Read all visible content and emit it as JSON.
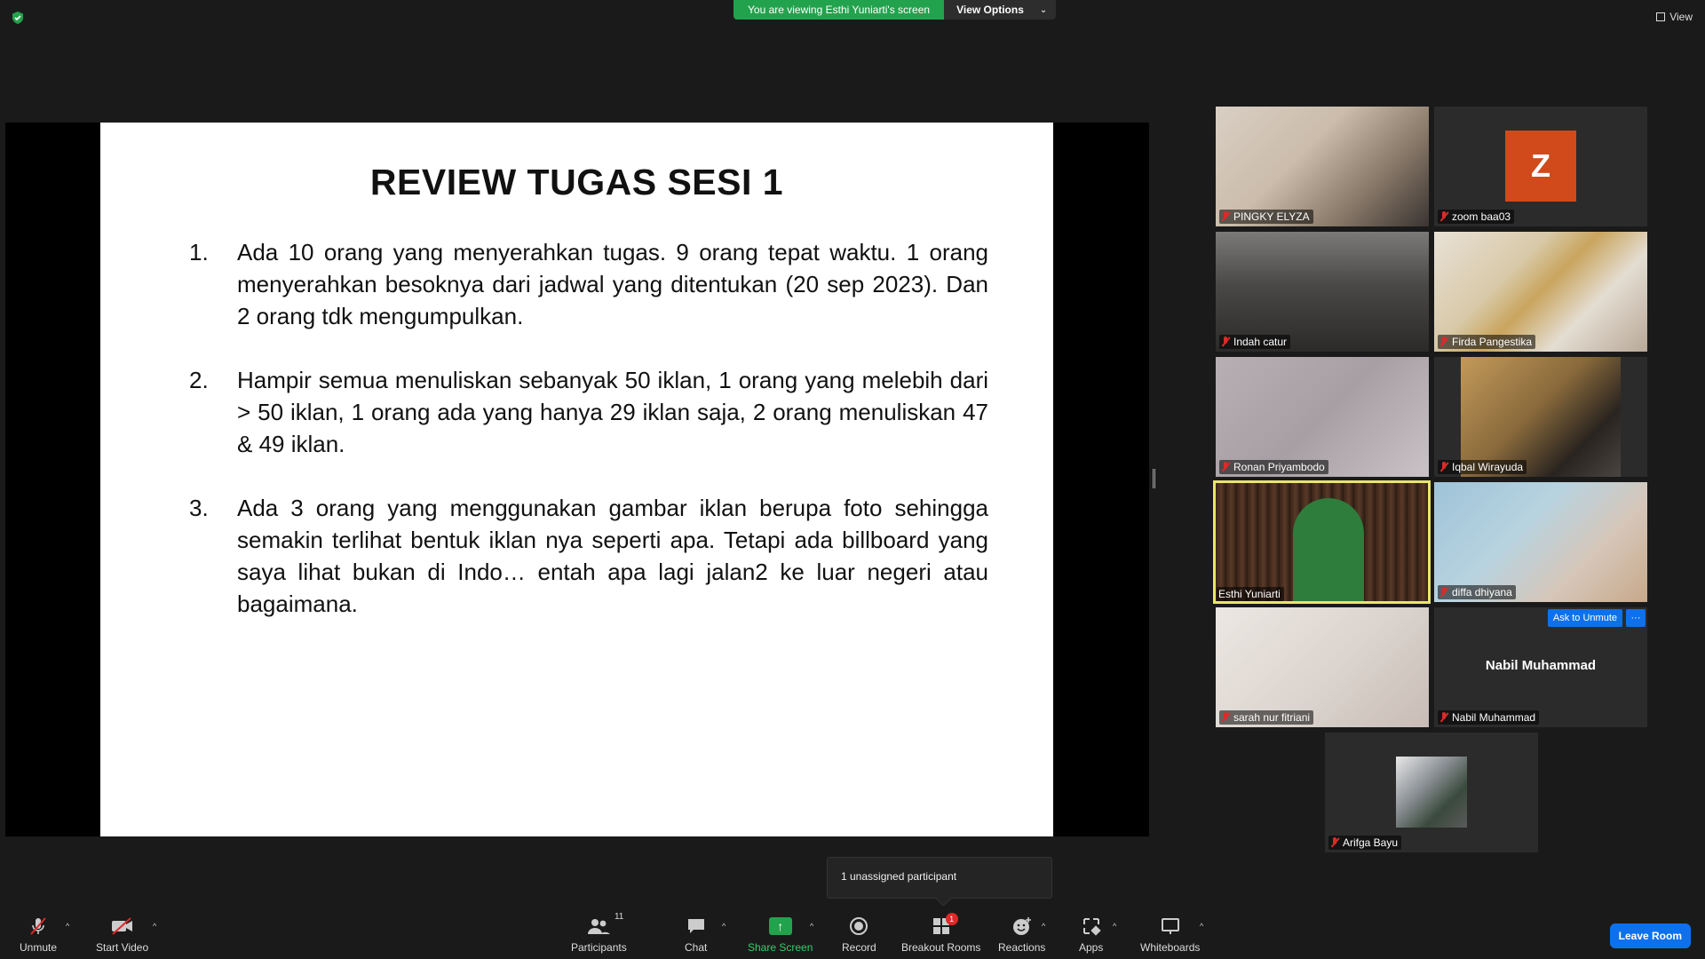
{
  "top": {
    "viewing_text": "You are viewing Esthi Yuniarti's screen",
    "view_options": "View Options",
    "view_label": "View"
  },
  "slide": {
    "title": "REVIEW TUGAS SESI 1",
    "items": [
      {
        "num": "1.",
        "text": "Ada 10 orang yang menyerahkan tugas. 9 orang tepat waktu. 1 orang menyerahkan besoknya dari jadwal yang ditentukan (20 sep 2023). Dan 2 orang tdk mengumpulkan."
      },
      {
        "num": "2.",
        "text": "Hampir semua menuliskan sebanyak 50 iklan, 1 orang yang melebih dari > 50 iklan, 1 orang ada  yang hanya 29 iklan saja, 2 orang menuliskan 47 & 49 iklan."
      },
      {
        "num": "3.",
        "text": "Ada 3 orang yang menggunakan gambar iklan berupa foto sehingga semakin terlihat bentuk iklan nya seperti apa. Tetapi ada billboard yang saya lihat bukan di Indo… entah apa lagi jalan2 ke luar negeri atau bagaimana."
      }
    ]
  },
  "participants": [
    {
      "name": "PINGKY ELYZA",
      "muted": true
    },
    {
      "name": "zoom baa03",
      "muted": true,
      "avatar_letter": "Z"
    },
    {
      "name": "Indah catur",
      "muted": true
    },
    {
      "name": "Firda Pangestika",
      "muted": true
    },
    {
      "name": "Ronan Priyambodo",
      "muted": true
    },
    {
      "name": "Iqbal Wirayuda",
      "muted": true
    },
    {
      "name": "Esthi Yuniarti",
      "muted": false,
      "active_speaker": true
    },
    {
      "name": "diffa dhiyana",
      "muted": true
    },
    {
      "name": "sarah nur fitriani",
      "muted": true
    },
    {
      "name": "Nabil Muhammad",
      "muted": true,
      "ask_to_unmute": "Ask to Unmute",
      "more": "···"
    },
    {
      "name": "Arifga Bayu",
      "muted": true
    }
  ],
  "tooltip": {
    "text": "1 unassigned participant"
  },
  "toolbar": {
    "unmute": "Unmute",
    "start_video": "Start Video",
    "participants": "Participants",
    "participants_count": "11",
    "chat": "Chat",
    "share_screen": "Share Screen",
    "record": "Record",
    "breakout_rooms": "Breakout Rooms",
    "breakout_badge": "1",
    "reactions": "Reactions",
    "apps": "Apps",
    "whiteboards": "Whiteboards",
    "leave_room": "Leave Room"
  },
  "colors": {
    "green": "#23a24d",
    "accent_blue": "#0e71eb",
    "active_border": "#e8e66b",
    "muted_red": "#e02828"
  }
}
